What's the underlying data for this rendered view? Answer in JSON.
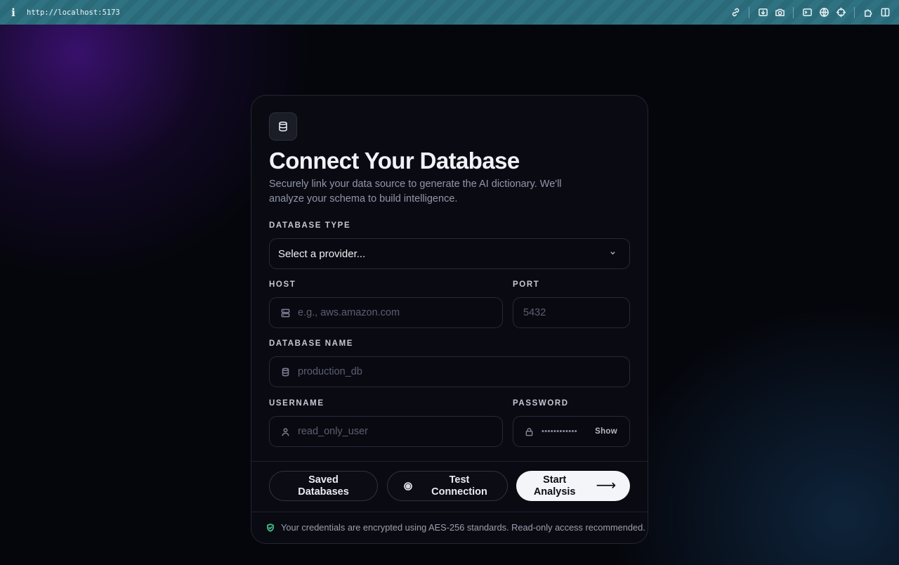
{
  "browser": {
    "url": "http://localhost:5173",
    "icons": [
      "info-icon",
      "link-icon",
      "install-icon",
      "camera-icon",
      "terminal-icon",
      "globe-icon",
      "crosshair-icon",
      "extensions-icon",
      "split-view-icon"
    ]
  },
  "card": {
    "icon": "database-icon",
    "title": "Connect Your Database",
    "subtitle": "Securely link your data source to generate the AI dictionary. We'll analyze your schema to build intelligence.",
    "database_type": {
      "label": "DATABASE TYPE",
      "value": "Select a provider..."
    },
    "host": {
      "label": "HOST",
      "placeholder": "e.g., aws.amazon.com"
    },
    "port": {
      "label": "PORT",
      "placeholder": "5432"
    },
    "database_name": {
      "label": "DATABASE NAME",
      "placeholder": "production_db"
    },
    "username": {
      "label": "USERNAME",
      "placeholder": "read_only_user"
    },
    "password": {
      "label": "PASSWORD",
      "masked": "••••••••••••",
      "toggle": "Show"
    },
    "buttons": {
      "saved": "Saved Databases",
      "test": "Test Connection",
      "start": "Start Analysis",
      "start_arrow": "⟶"
    },
    "footer": "Your credentials are encrypted using AES-256 standards. Read-only access recommended."
  },
  "colors": {
    "accent_purple": "#4a148c",
    "accent_green": "#3fbf86",
    "browser_bar": "#2f7383"
  }
}
